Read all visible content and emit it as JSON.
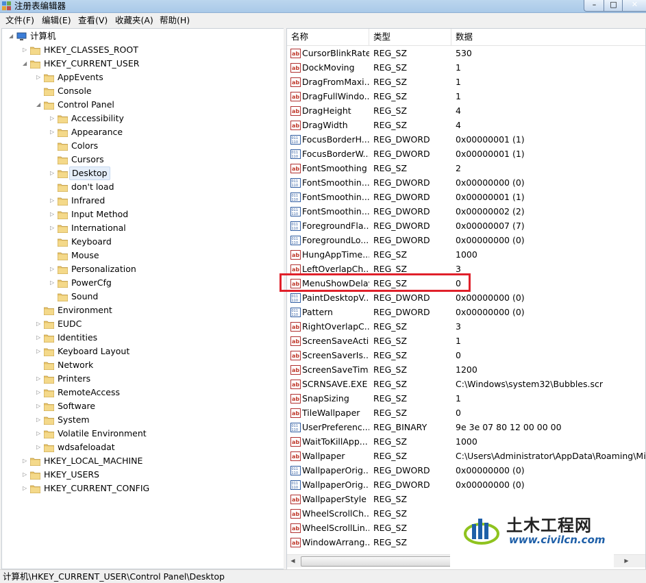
{
  "window": {
    "title": "注册表编辑器",
    "minimize_glyph": "–",
    "maximize_glyph": "□",
    "close_glyph": "✕"
  },
  "menu": [
    "文件(F)",
    "编辑(E)",
    "查看(V)",
    "收藏夹(A)",
    "帮助(H)"
  ],
  "tree": {
    "root": "计算机",
    "nodes": [
      {
        "label": "HKEY_CLASSES_ROOT",
        "level": 1,
        "expander": "collapsed"
      },
      {
        "label": "HKEY_CURRENT_USER",
        "level": 1,
        "expander": "expanded"
      },
      {
        "label": "AppEvents",
        "level": 2,
        "expander": "collapsed"
      },
      {
        "label": "Console",
        "level": 2,
        "expander": "none"
      },
      {
        "label": "Control Panel",
        "level": 2,
        "expander": "expanded"
      },
      {
        "label": "Accessibility",
        "level": 3,
        "expander": "collapsed"
      },
      {
        "label": "Appearance",
        "level": 3,
        "expander": "collapsed"
      },
      {
        "label": "Colors",
        "level": 3,
        "expander": "none"
      },
      {
        "label": "Cursors",
        "level": 3,
        "expander": "none"
      },
      {
        "label": "Desktop",
        "level": 3,
        "expander": "collapsed",
        "selected": true
      },
      {
        "label": "don't load",
        "level": 3,
        "expander": "none"
      },
      {
        "label": "Infrared",
        "level": 3,
        "expander": "collapsed"
      },
      {
        "label": "Input Method",
        "level": 3,
        "expander": "collapsed"
      },
      {
        "label": "International",
        "level": 3,
        "expander": "collapsed"
      },
      {
        "label": "Keyboard",
        "level": 3,
        "expander": "none"
      },
      {
        "label": "Mouse",
        "level": 3,
        "expander": "none"
      },
      {
        "label": "Personalization",
        "level": 3,
        "expander": "collapsed"
      },
      {
        "label": "PowerCfg",
        "level": 3,
        "expander": "collapsed"
      },
      {
        "label": "Sound",
        "level": 3,
        "expander": "none"
      },
      {
        "label": "Environment",
        "level": 2,
        "expander": "none"
      },
      {
        "label": "EUDC",
        "level": 2,
        "expander": "collapsed"
      },
      {
        "label": "Identities",
        "level": 2,
        "expander": "collapsed"
      },
      {
        "label": "Keyboard Layout",
        "level": 2,
        "expander": "collapsed"
      },
      {
        "label": "Network",
        "level": 2,
        "expander": "none"
      },
      {
        "label": "Printers",
        "level": 2,
        "expander": "collapsed"
      },
      {
        "label": "RemoteAccess",
        "level": 2,
        "expander": "collapsed"
      },
      {
        "label": "Software",
        "level": 2,
        "expander": "collapsed"
      },
      {
        "label": "System",
        "level": 2,
        "expander": "collapsed"
      },
      {
        "label": "Volatile Environment",
        "level": 2,
        "expander": "collapsed"
      },
      {
        "label": "wdsafeloadat",
        "level": 2,
        "expander": "collapsed"
      },
      {
        "label": "HKEY_LOCAL_MACHINE",
        "level": 1,
        "expander": "collapsed"
      },
      {
        "label": "HKEY_USERS",
        "level": 1,
        "expander": "collapsed"
      },
      {
        "label": "HKEY_CURRENT_CONFIG",
        "level": 1,
        "expander": "collapsed"
      }
    ]
  },
  "values": {
    "columns": [
      "名称",
      "类型",
      "数据"
    ],
    "rows": [
      {
        "name": "CursorBlinkRate",
        "type": "REG_SZ",
        "data": "530"
      },
      {
        "name": "DockMoving",
        "type": "REG_SZ",
        "data": "1"
      },
      {
        "name": "DragFromMaxi...",
        "type": "REG_SZ",
        "data": "1"
      },
      {
        "name": "DragFullWindo...",
        "type": "REG_SZ",
        "data": "1"
      },
      {
        "name": "DragHeight",
        "type": "REG_SZ",
        "data": "4"
      },
      {
        "name": "DragWidth",
        "type": "REG_SZ",
        "data": "4"
      },
      {
        "name": "FocusBorderH...",
        "type": "REG_DWORD",
        "data": "0x00000001 (1)"
      },
      {
        "name": "FocusBorderW...",
        "type": "REG_DWORD",
        "data": "0x00000001 (1)"
      },
      {
        "name": "FontSmoothing",
        "type": "REG_SZ",
        "data": "2"
      },
      {
        "name": "FontSmoothin...",
        "type": "REG_DWORD",
        "data": "0x00000000 (0)"
      },
      {
        "name": "FontSmoothin...",
        "type": "REG_DWORD",
        "data": "0x00000001 (1)"
      },
      {
        "name": "FontSmoothin...",
        "type": "REG_DWORD",
        "data": "0x00000002 (2)"
      },
      {
        "name": "ForegroundFla...",
        "type": "REG_DWORD",
        "data": "0x00000007 (7)"
      },
      {
        "name": "ForegroundLo...",
        "type": "REG_DWORD",
        "data": "0x00000000 (0)"
      },
      {
        "name": "HungAppTime...",
        "type": "REG_SZ",
        "data": "1000"
      },
      {
        "name": "LeftOverlapCh...",
        "type": "REG_SZ",
        "data": "3"
      },
      {
        "name": "MenuShowDelay",
        "type": "REG_SZ",
        "data": "0",
        "highlighted": true
      },
      {
        "name": "PaintDesktopV...",
        "type": "REG_DWORD",
        "data": "0x00000000 (0)"
      },
      {
        "name": "Pattern",
        "type": "REG_DWORD",
        "data": "0x00000000 (0)"
      },
      {
        "name": "RightOverlapC...",
        "type": "REG_SZ",
        "data": "3"
      },
      {
        "name": "ScreenSaveActi...",
        "type": "REG_SZ",
        "data": "1"
      },
      {
        "name": "ScreenSaverIs...",
        "type": "REG_SZ",
        "data": "0"
      },
      {
        "name": "ScreenSaveTim...",
        "type": "REG_SZ",
        "data": "1200"
      },
      {
        "name": "SCRNSAVE.EXE",
        "type": "REG_SZ",
        "data": "C:\\Windows\\system32\\Bubbles.scr"
      },
      {
        "name": "SnapSizing",
        "type": "REG_SZ",
        "data": "1"
      },
      {
        "name": "TileWallpaper",
        "type": "REG_SZ",
        "data": "0"
      },
      {
        "name": "UserPreferenc...",
        "type": "REG_BINARY",
        "data": "9e 3e 07 80 12 00 00 00"
      },
      {
        "name": "WaitToKillApp...",
        "type": "REG_SZ",
        "data": "1000"
      },
      {
        "name": "Wallpaper",
        "type": "REG_SZ",
        "data": "C:\\Users\\Administrator\\AppData\\Roaming\\Mi..."
      },
      {
        "name": "WallpaperOrig...",
        "type": "REG_DWORD",
        "data": "0x00000000 (0)"
      },
      {
        "name": "WallpaperOrig...",
        "type": "REG_DWORD",
        "data": "0x00000000 (0)"
      },
      {
        "name": "WallpaperStyle",
        "type": "REG_SZ",
        "data": ""
      },
      {
        "name": "WheelScrollCh...",
        "type": "REG_SZ",
        "data": ""
      },
      {
        "name": "WheelScrollLin...",
        "type": "REG_SZ",
        "data": ""
      },
      {
        "name": "WindowArrang...",
        "type": "REG_SZ",
        "data": ""
      }
    ],
    "scroll_left_glyph": "◀",
    "scroll_right_glyph": "▶"
  },
  "watermark": {
    "title": "土木工程网",
    "url": "www.civilcn.com"
  },
  "statusbar": {
    "path": "计算机\\HKEY_CURRENT_USER\\Control Panel\\Desktop"
  },
  "colors": {
    "highlight_box": "#e0202a",
    "selection": "#e5eefa",
    "folder": "#e8c46a"
  }
}
